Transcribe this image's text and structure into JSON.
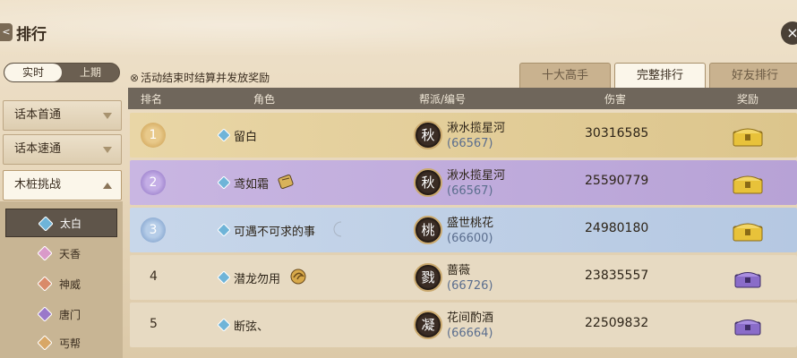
{
  "header": {
    "title": "排行",
    "back_label": "<",
    "close_label": "×"
  },
  "period_toggle": {
    "current": "实时",
    "previous": "上期"
  },
  "notice": "活动结束时结算并发放奖励",
  "tabs": [
    {
      "label": "十大高手",
      "active": false
    },
    {
      "label": "完整排行",
      "active": true
    },
    {
      "label": "好友排行",
      "active": false
    }
  ],
  "sidebar": {
    "categories": [
      {
        "label": "话本首通",
        "active": false
      },
      {
        "label": "话本速通",
        "active": false
      },
      {
        "label": "木桩挑战",
        "active": true
      }
    ],
    "subitems": [
      {
        "label": "太白",
        "gem_color": "#6fb4d8",
        "active": true
      },
      {
        "label": "天香",
        "gem_color": "#d99ac9",
        "active": false
      },
      {
        "label": "神威",
        "gem_color": "#d98a6a",
        "active": false
      },
      {
        "label": "唐门",
        "gem_color": "#9a78c9",
        "active": false
      },
      {
        "label": "丐帮",
        "gem_color": "#d8a766",
        "active": false
      }
    ]
  },
  "table": {
    "headers": {
      "rank": "排名",
      "role": "角色",
      "guild": "帮派/编号",
      "damage": "伤害",
      "reward": "奖励"
    },
    "rows": [
      {
        "rank": "1",
        "name": "留白",
        "guild_char": "秋",
        "guild": "湫水揽星河",
        "guild_id": "(66567)",
        "damage": "30316585",
        "tier": "gold",
        "chest": "gold",
        "title_icon": ""
      },
      {
        "rank": "2",
        "name": "鸢如霜",
        "guild_char": "秋",
        "guild": "湫水揽星河",
        "guild_id": "(66567)",
        "damage": "25590779",
        "tier": "purple",
        "chest": "gold",
        "title_icon": "scroll-icon"
      },
      {
        "rank": "3",
        "name": "可遇不可求的事",
        "guild_char": "桃",
        "guild": "盛世桃花",
        "guild_id": "(66600)",
        "damage": "24980180",
        "tier": "blue",
        "chest": "gold",
        "title_icon": "moon-icon"
      },
      {
        "rank": "4",
        "name": "潜龙勿用",
        "guild_char": "戮",
        "guild": "蔷薇",
        "guild_id": "(66726)",
        "damage": "23835557",
        "tier": "plain",
        "chest": "purple",
        "title_icon": "dragon-icon"
      },
      {
        "rank": "5",
        "name": "断弦、",
        "guild_char": "凝",
        "guild": "花间酌酒",
        "guild_id": "(66664)",
        "damage": "22509832",
        "tier": "plain",
        "chest": "purple",
        "title_icon": ""
      }
    ]
  },
  "colors": {
    "gold_chest": "#e8c23a",
    "purple_chest": "#8a6cc9",
    "rank1": "#d9b56c",
    "rank2": "#9c7fc8",
    "rank3": "#7aa1cf"
  }
}
